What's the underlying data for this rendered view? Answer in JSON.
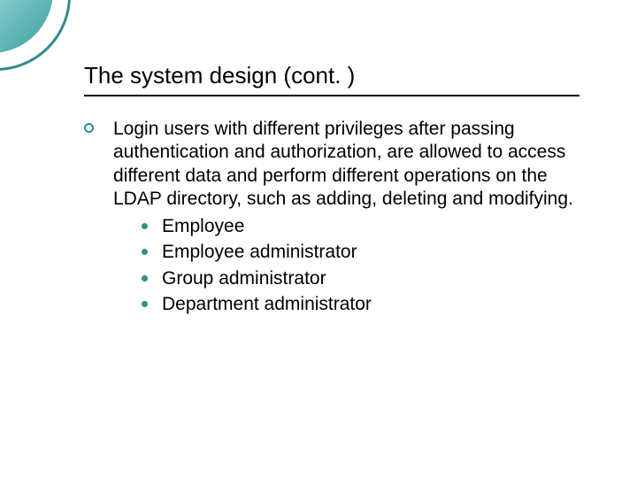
{
  "title": "The system design (cont. )",
  "bullet": {
    "text": "Login users with different privileges after passing authentication and authorization, are allowed to access different data and perform different operations on the LDAP directory, such as adding, deleting and modifying.",
    "subitems": [
      "Employee",
      "Employee administrator",
      "Group administrator",
      "Department administrator"
    ]
  },
  "colors": {
    "accent": "#2f8d8d"
  }
}
